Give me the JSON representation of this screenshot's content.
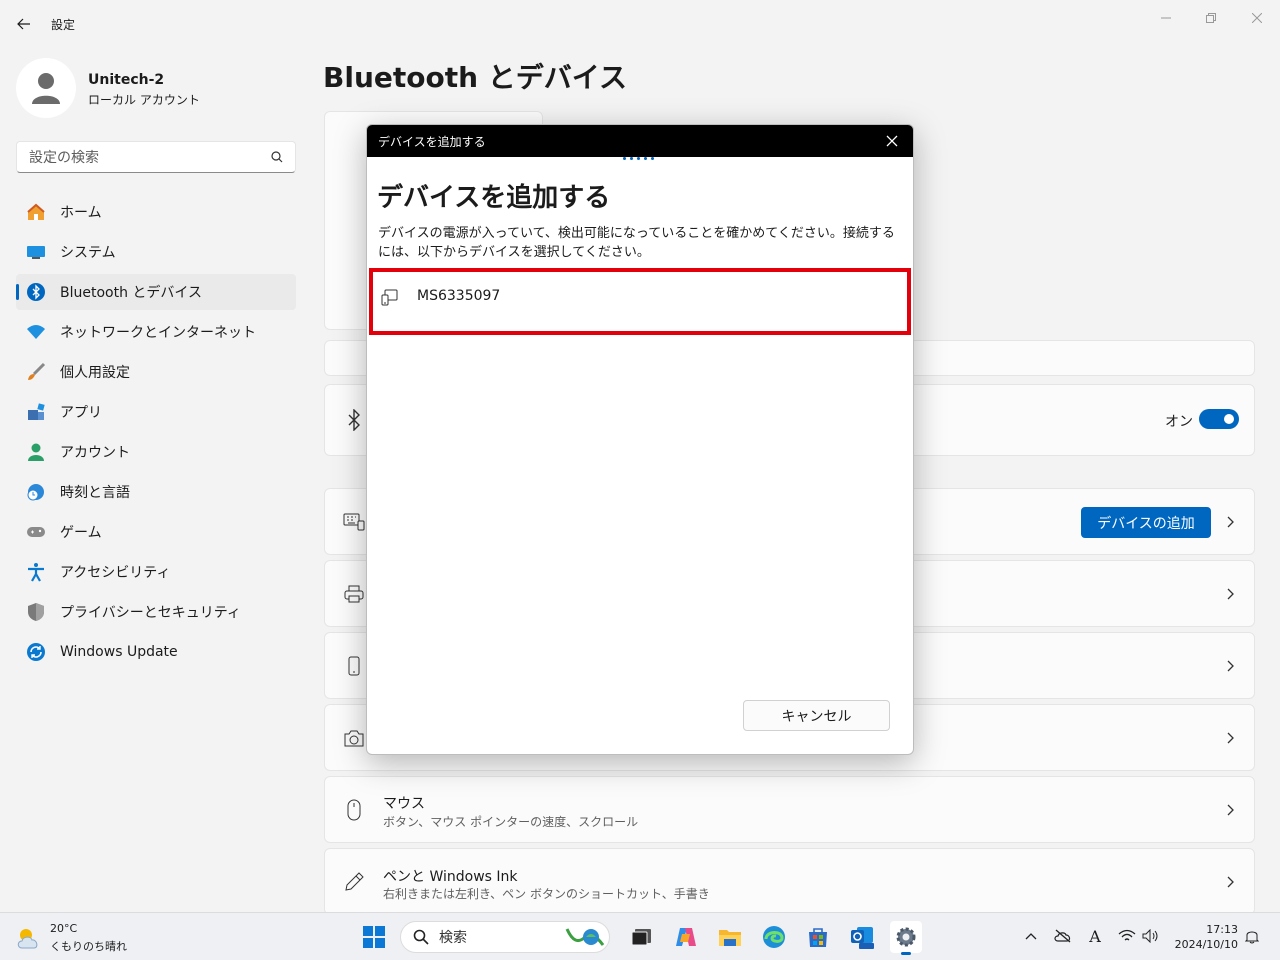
{
  "window": {
    "title": "設定"
  },
  "profile": {
    "name": "Unitech-2",
    "account_type": "ローカル アカウント"
  },
  "search": {
    "placeholder": "設定の検索"
  },
  "nav": [
    {
      "label": "ホーム",
      "icon": "home-icon"
    },
    {
      "label": "システム",
      "icon": "system-icon"
    },
    {
      "label": "Bluetooth とデバイス",
      "icon": "bluetooth-icon",
      "active": true
    },
    {
      "label": "ネットワークとインターネット",
      "icon": "wifi-icon"
    },
    {
      "label": "個人用設定",
      "icon": "brush-icon"
    },
    {
      "label": "アプリ",
      "icon": "apps-icon"
    },
    {
      "label": "アカウント",
      "icon": "account-icon"
    },
    {
      "label": "時刻と言語",
      "icon": "clock-globe-icon"
    },
    {
      "label": "ゲーム",
      "icon": "gamepad-icon"
    },
    {
      "label": "アクセシビリティ",
      "icon": "accessibility-icon"
    },
    {
      "label": "プライバシーとセキュリティ",
      "icon": "shield-icon"
    },
    {
      "label": "Windows Update",
      "icon": "update-icon"
    }
  ],
  "main": {
    "title": "Bluetooth とデバイス",
    "bluetooth_toggle_label": "オン",
    "add_device_button": "デバイスの追加",
    "mouse": {
      "title": "マウス",
      "subtitle": "ボタン、マウス ポインターの速度、スクロール"
    },
    "pen": {
      "title": "ペンと Windows Ink",
      "subtitle": "右利きまたは左利き、ペン ボタンのショートカット、手書き"
    }
  },
  "dialog": {
    "window_title": "デバイスを追加する",
    "heading": "デバイスを追加する",
    "description": "デバイスの電源が入っていて、検出可能になっていることを確かめてください。接続するには、以下からデバイスを選択してください。",
    "found_device": "MS6335097",
    "cancel_button": "キャンセル"
  },
  "taskbar": {
    "weather_temp": "20°C",
    "weather_desc": "くもりのち晴れ",
    "search_placeholder": "検索",
    "time": "17:13",
    "date": "2024/10/10"
  },
  "colors": {
    "accent": "#0067c0",
    "highlight": "#e3000b"
  }
}
